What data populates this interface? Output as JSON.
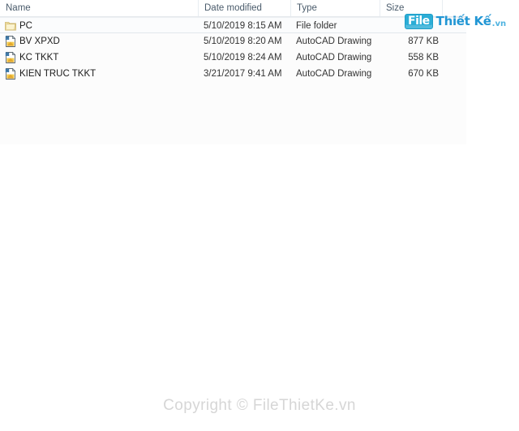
{
  "file_list": {
    "columns": [
      {
        "key": "name",
        "label": "Name"
      },
      {
        "key": "date",
        "label": "Date modified"
      },
      {
        "key": "type",
        "label": "Type"
      },
      {
        "key": "size",
        "label": "Size"
      }
    ],
    "rows": [
      {
        "name": "PC",
        "date": "5/10/2019 8:15 AM",
        "type": "File folder",
        "size": "",
        "icon": "folder-icon",
        "selected": true
      },
      {
        "name": "BV XPXD",
        "date": "5/10/2019 8:20 AM",
        "type": "AutoCAD Drawing",
        "size": "877 KB",
        "icon": "autocad-drawing-icon",
        "selected": false
      },
      {
        "name": "KC TKKT",
        "date": "5/10/2019 8:24 AM",
        "type": "AutoCAD Drawing",
        "size": "558 KB",
        "icon": "autocad-drawing-icon",
        "selected": false
      },
      {
        "name": "KIEN TRUC TKKT",
        "date": "3/21/2017 9:41 AM",
        "type": "AutoCAD Drawing",
        "size": "670 KB",
        "icon": "autocad-drawing-icon",
        "selected": false
      }
    ]
  },
  "watermark": {
    "logo_box_text": "File",
    "logo_brand_text": "Thiết Kế",
    "logo_tld_text": ".vn",
    "logo_box_color": "#2badd6",
    "logo_brand_color": "#2196d4"
  },
  "footer": {
    "copyright": "Copyright © FileThietKe.vn",
    "color": "#d6d6d6"
  }
}
